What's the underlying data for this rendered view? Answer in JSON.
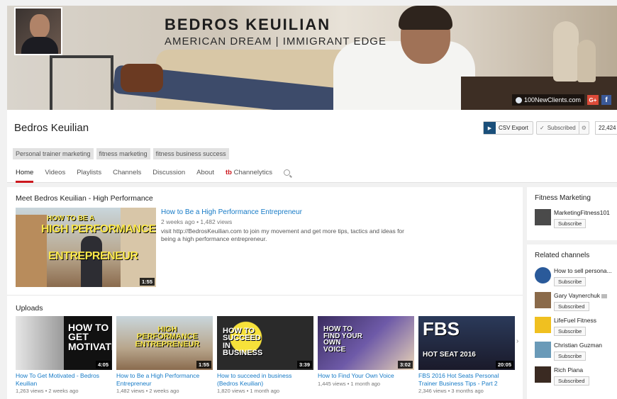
{
  "banner": {
    "title": "BEDROS KEUILIAN",
    "subtitle": "AMERICAN DREAM | IMMIGRANT EDGE",
    "link_label": "100NewClients.com",
    "gplus_label": "G+",
    "fb_label": "f"
  },
  "channel": {
    "name": "Bedros Keuilian",
    "csv_label": "CSV Export",
    "subscribed_label": "Subscribed",
    "subscriber_count": "22,424",
    "tags": [
      "Personal trainer marketing",
      "fitness marketing",
      "fitness business success"
    ],
    "tabs": [
      {
        "label": "Home",
        "active": true
      },
      {
        "label": "Videos"
      },
      {
        "label": "Playlists"
      },
      {
        "label": "Channels"
      },
      {
        "label": "Discussion"
      },
      {
        "label": "About"
      },
      {
        "prefix": "tb",
        "label": "Channelytics"
      }
    ]
  },
  "featured": {
    "section_title": "Meet Bedros Keuilian - High Performance",
    "thumb_text": [
      "HOW TO BE A",
      "HIGH PERFORMANCE",
      "ENTREPRENEUR"
    ],
    "duration": "1:55",
    "title": "How to Be a High Performance Entrepreneur",
    "meta": "2 weeks ago • 1,482 views",
    "description": "visit http://BedrosKeuilian.com to join my movement and get more tips, tactics and ideas for being a high performance entrepreneur."
  },
  "uploads": {
    "section_title": "Uploads",
    "next_arrow": "›",
    "videos": [
      {
        "title": "How To Get Motivated - Bedros Keuilian",
        "meta": "1,263 views • 2 weeks ago",
        "duration": "4:05",
        "thumb_text": "HOW TO GET MOTIVATED"
      },
      {
        "title": "How to Be a High Performance Entrepreneur",
        "meta": "1,482 views • 2 weeks ago",
        "duration": "1:55",
        "thumb_text": "HIGH PERFORMANCE ENTREPRENEUR"
      },
      {
        "title": "How to succeed in business (Bedros Keuilian)",
        "meta": "1,820 views • 1 month ago",
        "duration": "3:39",
        "thumb_text": "HOW TO SUCCEED IN BUSINESS"
      },
      {
        "title": "How to Find Your Own Voice",
        "meta": "1,445 views • 1 month ago",
        "duration": "3:02",
        "thumb_text": "HOW TO FIND YOUR OWN VOICE"
      },
      {
        "title": "FBS 2016 Hot Seats Personal Trainer Business Tips - Part 2",
        "meta": "2,346 views • 3 months ago",
        "duration": "20:05",
        "thumb_text": "FBS",
        "thumb_sub": "HOT SEAT 2016"
      }
    ]
  },
  "sidebar": {
    "fitness_title": "Fitness Marketing",
    "fitness_channel": {
      "name": "MarketingFitness101",
      "button": "Subscribe"
    },
    "related_title": "Related channels",
    "related": [
      {
        "name": "How to sell persona...",
        "button": "Subscribe"
      },
      {
        "name": "Gary Vaynerchuk",
        "button": "Subscribed"
      },
      {
        "name": "LifeFuel Fitness",
        "button": "Subscribe"
      },
      {
        "name": "Christian Guzman",
        "button": "Subscribe"
      },
      {
        "name": "Rich Piana",
        "button": "Subscribed"
      }
    ]
  }
}
